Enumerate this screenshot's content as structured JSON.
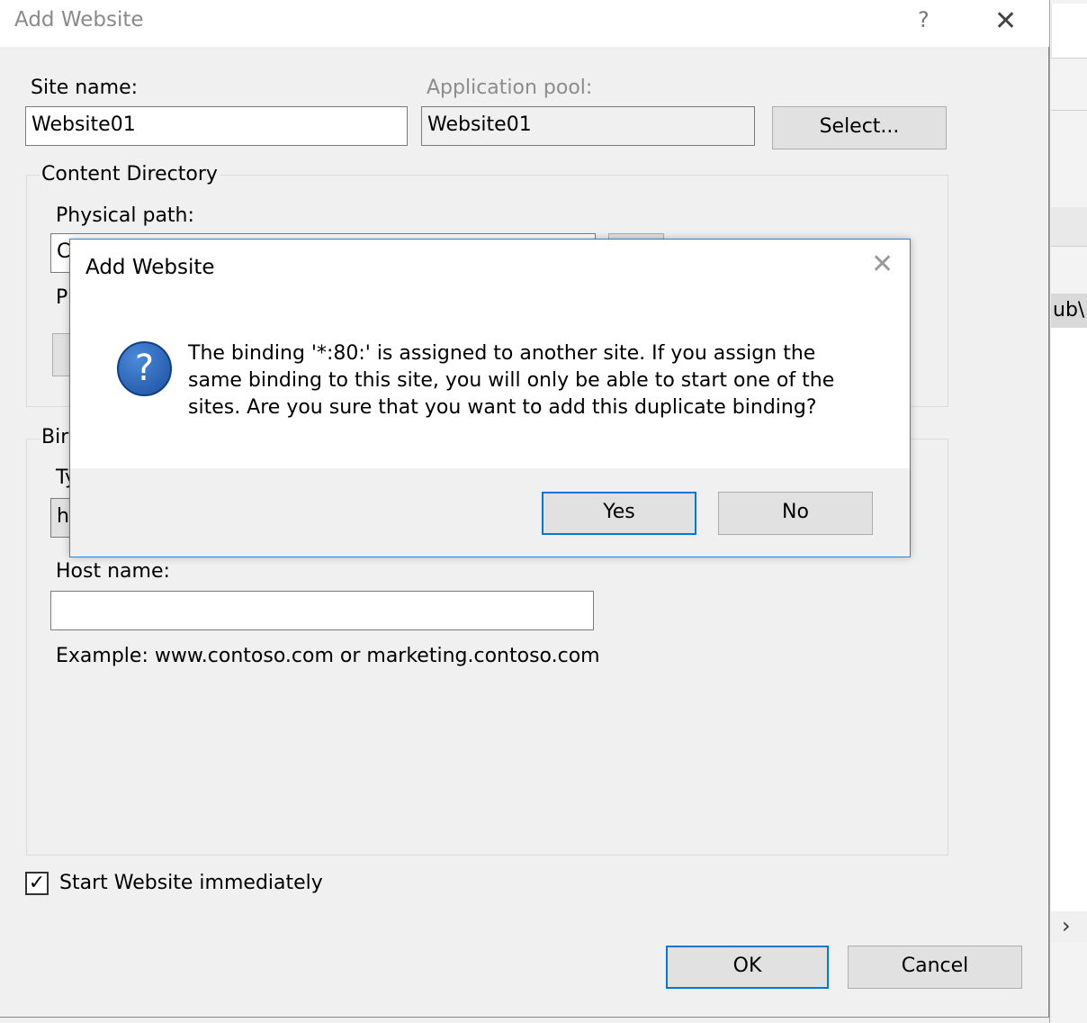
{
  "dialog": {
    "title": "Add Website",
    "help_glyph": "?",
    "close_glyph": "✕",
    "site_name_label": "Site name:",
    "site_name_value": "Website01",
    "app_pool_label": "Application pool:",
    "app_pool_value": "Website01",
    "select_button": "Select...",
    "content_directory_caption": "Content Directory",
    "physical_path_label": "Physical path:",
    "physical_path_value_partial": "C",
    "pass_through_partial": "P",
    "binding_caption_partial": "Bir",
    "type_label_partial": "Ty",
    "type_value_partial": "h",
    "host_name_label": "Host name:",
    "host_name_value": "",
    "example_text": "Example: www.contoso.com or marketing.contoso.com",
    "start_immediately_label": "Start Website immediately",
    "start_immediately_checked": true,
    "ok_button": "OK",
    "cancel_button": "Cancel"
  },
  "modal": {
    "title": "Add Website",
    "close_glyph": "✕",
    "icon": "question-icon",
    "icon_glyph": "?",
    "message": "The binding '*:80:' is assigned to another site. If you assign the same binding to this site, you will only be able to start one of the sites. Are you sure that you want to add this duplicate binding?",
    "yes_button": "Yes",
    "no_button": "No"
  },
  "background_window": {
    "path_fragment": "ub\\",
    "arrow_glyph": "›"
  }
}
